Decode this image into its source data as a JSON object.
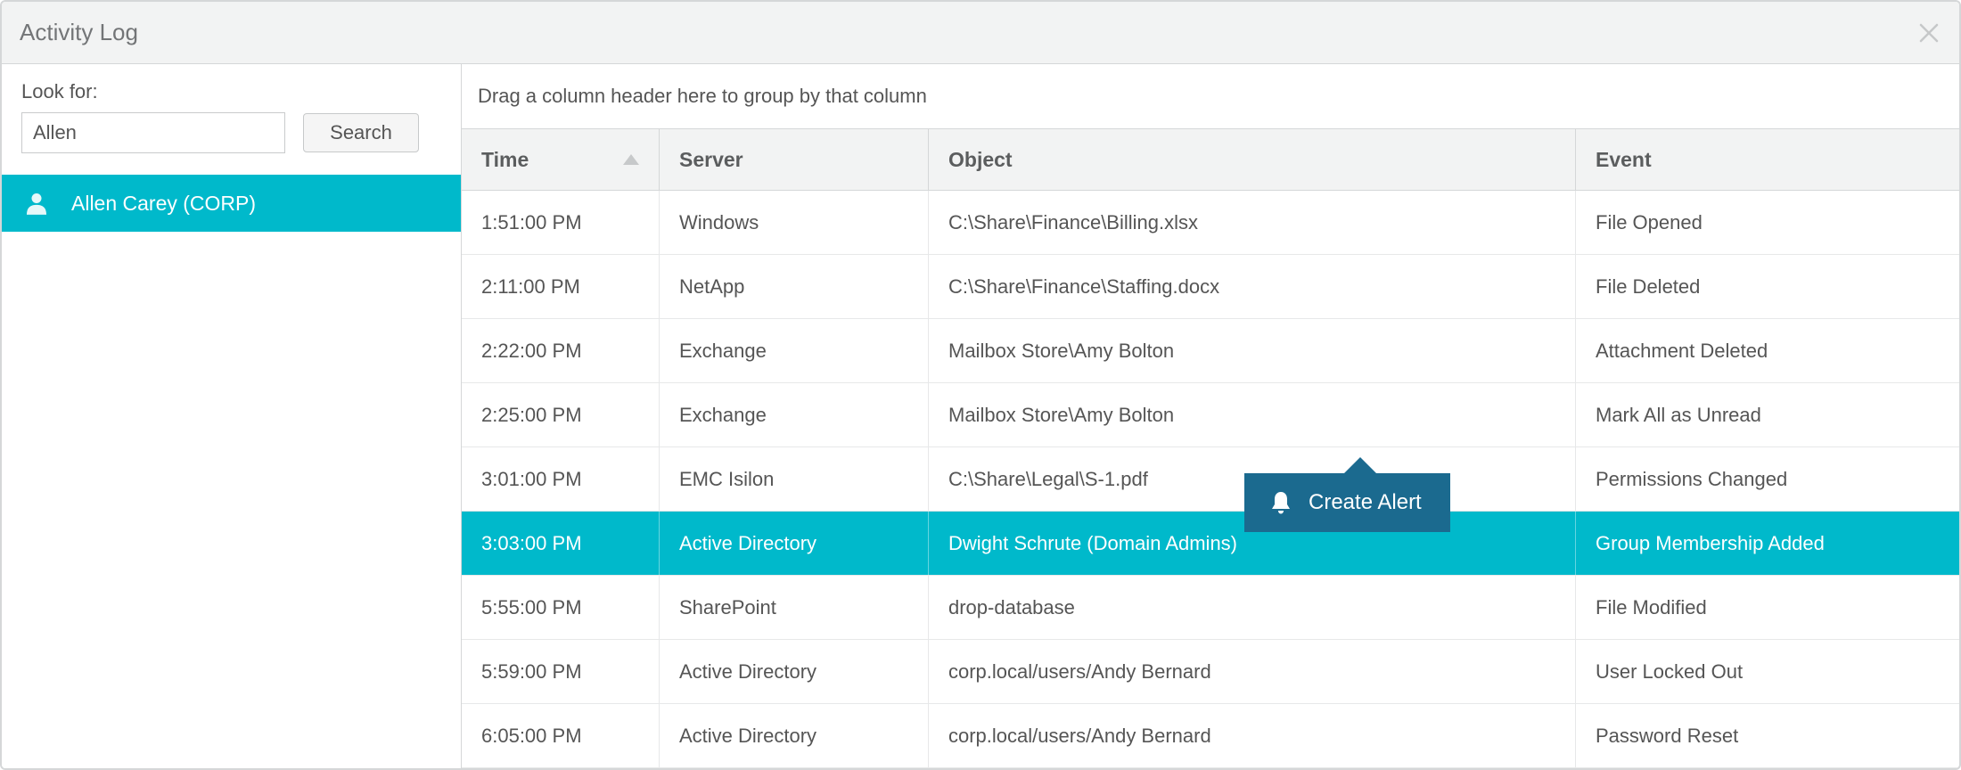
{
  "window": {
    "title": "Activity Log"
  },
  "sidebar": {
    "look_for_label": "Look for:",
    "search_value": "Allen",
    "search_button": "Search",
    "results": [
      {
        "label": "Allen Carey (CORP)"
      }
    ]
  },
  "main": {
    "group_hint": "Drag a column header here to group by that column",
    "columns": {
      "time": "Time",
      "server": "Server",
      "object": "Object",
      "event": "Event"
    },
    "rows": [
      {
        "time": "1:51:00 PM",
        "server": "Windows",
        "object": "C:\\Share\\Finance\\Billing.xlsx",
        "event": "File Opened",
        "selected": false
      },
      {
        "time": "2:11:00 PM",
        "server": "NetApp",
        "object": "C:\\Share\\Finance\\Staffing.docx",
        "event": "File Deleted",
        "selected": false
      },
      {
        "time": "2:22:00 PM",
        "server": "Exchange",
        "object": "Mailbox Store\\Amy Bolton",
        "event": "Attachment Deleted",
        "selected": false
      },
      {
        "time": "2:25:00 PM",
        "server": "Exchange",
        "object": "Mailbox Store\\Amy Bolton",
        "event": "Mark All as Unread",
        "selected": false
      },
      {
        "time": "3:01:00 PM",
        "server": "EMC Isilon",
        "object": "C:\\Share\\Legal\\S-1.pdf",
        "event": "Permissions Changed",
        "selected": false
      },
      {
        "time": "3:03:00 PM",
        "server": "Active Directory",
        "object": "Dwight Schrute (Domain Admins)",
        "event": "Group Membership Added",
        "selected": true
      },
      {
        "time": "5:55:00 PM",
        "server": "SharePoint",
        "object": "drop-database",
        "event": "File Modified",
        "selected": false
      },
      {
        "time": "5:59:00 PM",
        "server": "Active Directory",
        "object": "corp.local/users/Andy Bernard",
        "event": "User Locked Out",
        "selected": false
      },
      {
        "time": "6:05:00 PM",
        "server": "Active Directory",
        "object": "corp.local/users/Andy Bernard",
        "event": "Password Reset",
        "selected": false
      }
    ],
    "tooltip_label": "Create Alert"
  }
}
